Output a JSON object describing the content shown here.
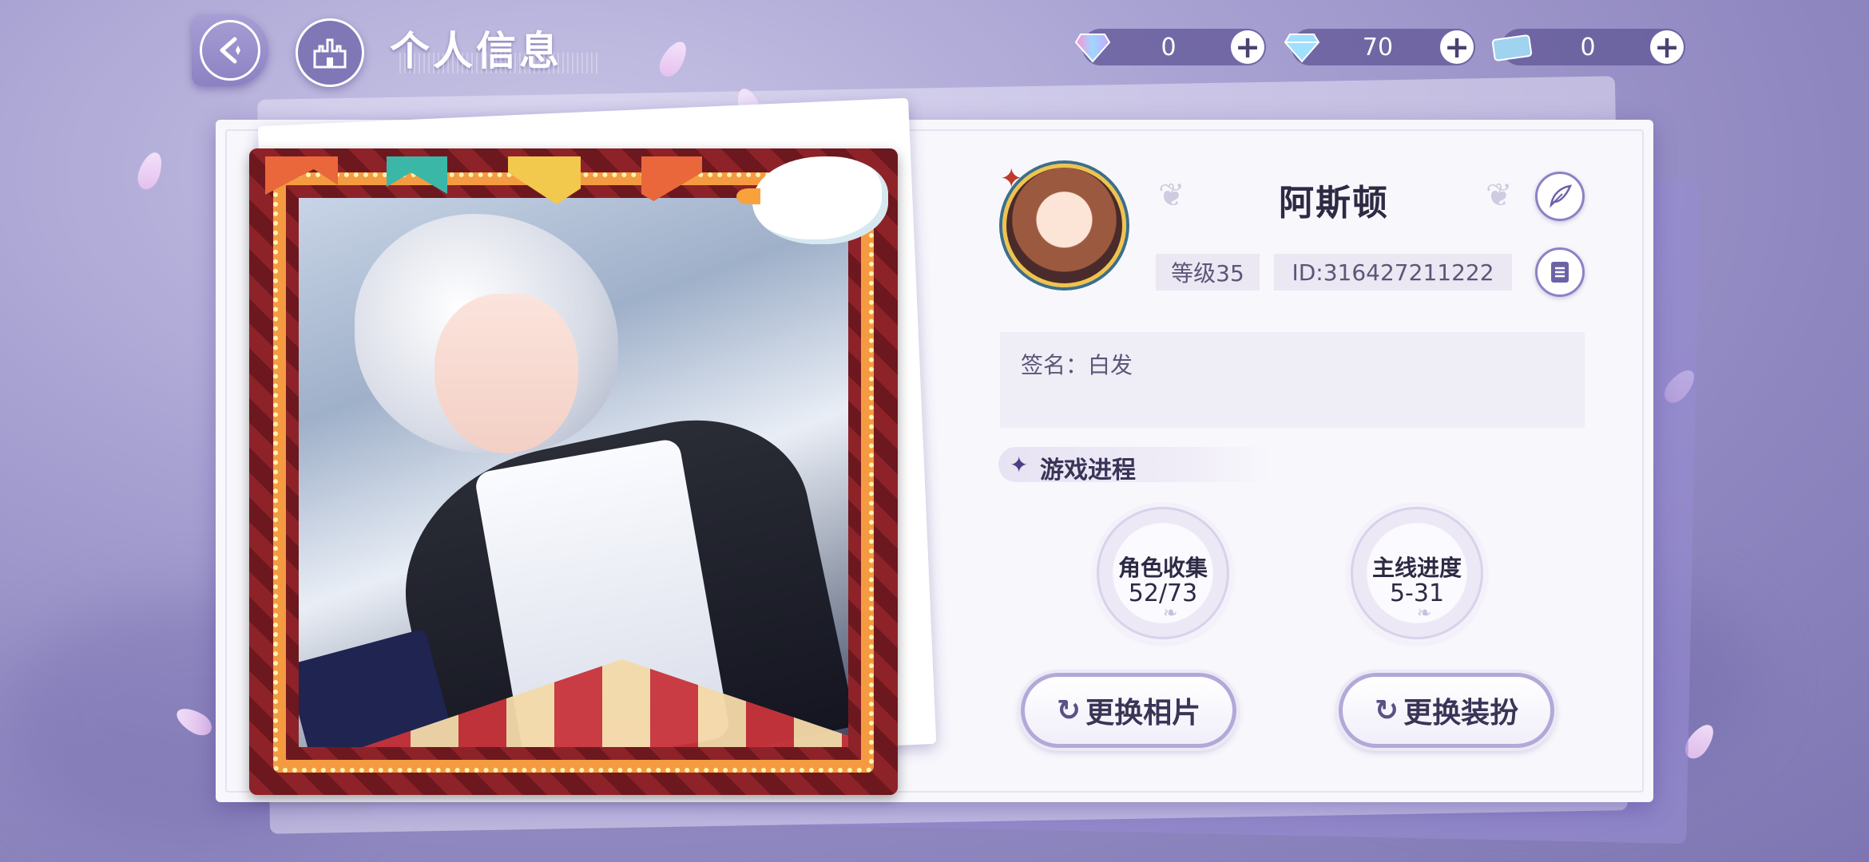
{
  "header": {
    "title": "个人信息",
    "back_icon": "back-arrow-icon",
    "home_icon": "castle-icon"
  },
  "currencies": [
    {
      "icon": "rainbow-diamond-icon",
      "value": "0"
    },
    {
      "icon": "blue-diamond-icon",
      "value": "70"
    },
    {
      "icon": "ticket-icon",
      "value": "0"
    }
  ],
  "profile": {
    "name": "阿斯顿",
    "level": "等级35",
    "id": "ID:316427211222",
    "signature": "签名：白发"
  },
  "progress": {
    "section_title": "游戏进程",
    "stats": [
      {
        "label": "角色收集",
        "value": "52/73"
      },
      {
        "label": "主线进度",
        "value": "5-31"
      }
    ]
  },
  "actions": {
    "change_photo": "更换相片",
    "change_outfit": "更换装扮"
  },
  "colors": {
    "accent": "#8c82c3",
    "text_dark": "#2d2a44",
    "card_bg": "#f8f7fc"
  }
}
